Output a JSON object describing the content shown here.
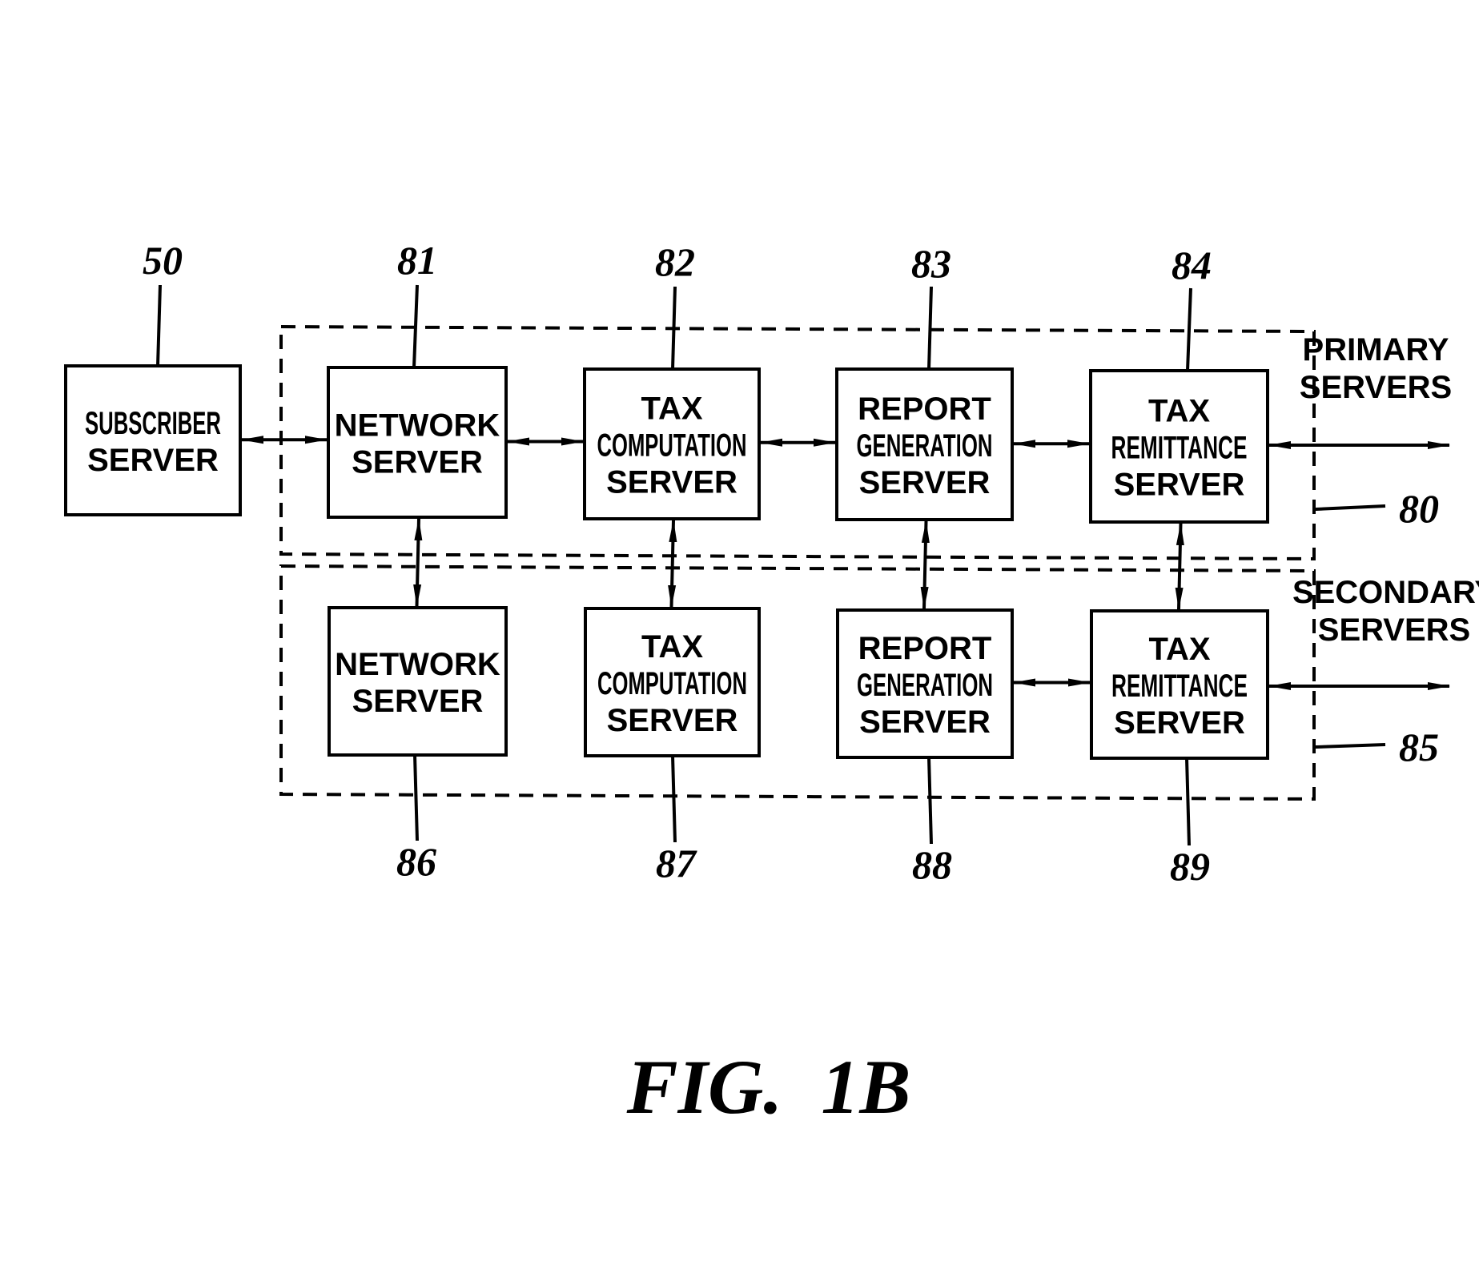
{
  "figure": {
    "caption": "FIG.  1B"
  },
  "groups": {
    "primary": {
      "ref": "80",
      "label_lines": [
        "PRIMARY",
        "SERVERS"
      ]
    },
    "secondary": {
      "ref": "85",
      "label_lines": [
        "SECONDARY",
        "SERVERS"
      ]
    }
  },
  "nodes": {
    "subscriber": {
      "ref": "50",
      "lines": [
        "SUBSCRIBER",
        "SERVER"
      ]
    },
    "p_network": {
      "ref": "81",
      "lines": [
        "NETWORK",
        "SERVER"
      ]
    },
    "p_taxcomp": {
      "ref": "82",
      "lines": [
        "TAX",
        "COMPUTATION",
        "SERVER"
      ]
    },
    "p_report": {
      "ref": "83",
      "lines": [
        "REPORT",
        "GENERATION",
        "SERVER"
      ]
    },
    "p_remit": {
      "ref": "84",
      "lines": [
        "TAX",
        "REMITTANCE",
        "SERVER"
      ]
    },
    "s_network": {
      "ref": "86",
      "lines": [
        "NETWORK",
        "SERVER"
      ]
    },
    "s_taxcomp": {
      "ref": "87",
      "lines": [
        "TAX",
        "COMPUTATION",
        "SERVER"
      ]
    },
    "s_report": {
      "ref": "88",
      "lines": [
        "REPORT",
        "GENERATION",
        "SERVER"
      ]
    },
    "s_remit": {
      "ref": "89",
      "lines": [
        "TAX",
        "REMITTANCE",
        "SERVER"
      ]
    }
  },
  "connections": [
    {
      "from": "subscriber",
      "to": "p_network",
      "type": "bidirectional"
    },
    {
      "from": "p_network",
      "to": "p_taxcomp",
      "type": "bidirectional"
    },
    {
      "from": "p_taxcomp",
      "to": "p_report",
      "type": "bidirectional"
    },
    {
      "from": "p_report",
      "to": "p_remit",
      "type": "bidirectional"
    },
    {
      "from": "p_remit",
      "to": "external",
      "type": "bidirectional"
    },
    {
      "from": "p_network",
      "to": "s_network",
      "type": "bidirectional"
    },
    {
      "from": "p_taxcomp",
      "to": "s_taxcomp",
      "type": "bidirectional"
    },
    {
      "from": "p_report",
      "to": "s_report",
      "type": "bidirectional"
    },
    {
      "from": "p_remit",
      "to": "s_remit",
      "type": "bidirectional"
    },
    {
      "from": "s_report",
      "to": "s_remit",
      "type": "bidirectional"
    },
    {
      "from": "s_remit",
      "to": "external",
      "type": "bidirectional"
    }
  ]
}
